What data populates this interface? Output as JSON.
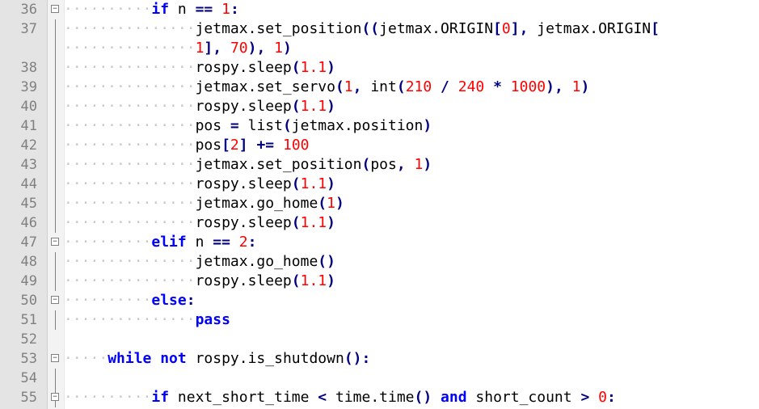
{
  "editor": {
    "lines": [
      {
        "n": "36",
        "fold": "minus",
        "indent": 2,
        "tokens": [
          [
            "kw",
            "if"
          ],
          [
            "def",
            " n "
          ],
          [
            "op",
            "=="
          ],
          [
            "def",
            " "
          ],
          [
            "num",
            "1"
          ],
          [
            "op",
            ":"
          ]
        ]
      },
      {
        "n": "37",
        "fold": "",
        "indent": 3,
        "tokens": [
          [
            "def",
            "jetmax.set_position"
          ],
          [
            "op",
            "(("
          ],
          [
            "def",
            "jetmax.ORIGIN"
          ],
          [
            "op",
            "["
          ],
          [
            "num",
            "0"
          ],
          [
            "op",
            "],"
          ],
          [
            "def",
            " jetmax.ORIGIN"
          ],
          [
            "op",
            "["
          ]
        ]
      },
      {
        "n": "",
        "fold": "",
        "indent": 3,
        "tokens": [
          [
            "num",
            "1"
          ],
          [
            "op",
            "],"
          ],
          [
            "def",
            " "
          ],
          [
            "num",
            "70"
          ],
          [
            "op",
            "),"
          ],
          [
            "def",
            " "
          ],
          [
            "num",
            "1"
          ],
          [
            "op",
            ")"
          ]
        ]
      },
      {
        "n": "38",
        "fold": "",
        "indent": 3,
        "tokens": [
          [
            "def",
            "rospy.sleep"
          ],
          [
            "op",
            "("
          ],
          [
            "num",
            "1.1"
          ],
          [
            "op",
            ")"
          ]
        ]
      },
      {
        "n": "39",
        "fold": "",
        "indent": 3,
        "tokens": [
          [
            "def",
            "jetmax.set_servo"
          ],
          [
            "op",
            "("
          ],
          [
            "num",
            "1"
          ],
          [
            "op",
            ","
          ],
          [
            "def",
            " int"
          ],
          [
            "op",
            "("
          ],
          [
            "num",
            "210"
          ],
          [
            "def",
            " "
          ],
          [
            "op",
            "/"
          ],
          [
            "def",
            " "
          ],
          [
            "num",
            "240"
          ],
          [
            "def",
            " "
          ],
          [
            "op",
            "*"
          ],
          [
            "def",
            " "
          ],
          [
            "num",
            "1000"
          ],
          [
            "op",
            "),"
          ],
          [
            "def",
            " "
          ],
          [
            "num",
            "1"
          ],
          [
            "op",
            ")"
          ]
        ]
      },
      {
        "n": "40",
        "fold": "",
        "indent": 3,
        "tokens": [
          [
            "def",
            "rospy.sleep"
          ],
          [
            "op",
            "("
          ],
          [
            "num",
            "1.1"
          ],
          [
            "op",
            ")"
          ]
        ]
      },
      {
        "n": "41",
        "fold": "",
        "indent": 3,
        "tokens": [
          [
            "def",
            "pos "
          ],
          [
            "op",
            "="
          ],
          [
            "def",
            " list"
          ],
          [
            "op",
            "("
          ],
          [
            "def",
            "jetmax.position"
          ],
          [
            "op",
            ")"
          ]
        ]
      },
      {
        "n": "42",
        "fold": "",
        "indent": 3,
        "tokens": [
          [
            "def",
            "pos"
          ],
          [
            "op",
            "["
          ],
          [
            "num",
            "2"
          ],
          [
            "op",
            "]"
          ],
          [
            "def",
            " "
          ],
          [
            "op",
            "+="
          ],
          [
            "def",
            " "
          ],
          [
            "num",
            "100"
          ]
        ]
      },
      {
        "n": "43",
        "fold": "",
        "indent": 3,
        "tokens": [
          [
            "def",
            "jetmax.set_position"
          ],
          [
            "op",
            "("
          ],
          [
            "def",
            "pos"
          ],
          [
            "op",
            ","
          ],
          [
            "def",
            " "
          ],
          [
            "num",
            "1"
          ],
          [
            "op",
            ")"
          ]
        ]
      },
      {
        "n": "44",
        "fold": "",
        "indent": 3,
        "tokens": [
          [
            "def",
            "rospy.sleep"
          ],
          [
            "op",
            "("
          ],
          [
            "num",
            "1.1"
          ],
          [
            "op",
            ")"
          ]
        ]
      },
      {
        "n": "45",
        "fold": "",
        "indent": 3,
        "tokens": [
          [
            "def",
            "jetmax.go_home"
          ],
          [
            "op",
            "("
          ],
          [
            "num",
            "1"
          ],
          [
            "op",
            ")"
          ]
        ]
      },
      {
        "n": "46",
        "fold": "",
        "indent": 3,
        "tokens": [
          [
            "def",
            "rospy.sleep"
          ],
          [
            "op",
            "("
          ],
          [
            "num",
            "1.1"
          ],
          [
            "op",
            ")"
          ]
        ]
      },
      {
        "n": "47",
        "fold": "minus",
        "indent": 2,
        "tokens": [
          [
            "kw",
            "elif"
          ],
          [
            "def",
            " n "
          ],
          [
            "op",
            "=="
          ],
          [
            "def",
            " "
          ],
          [
            "num",
            "2"
          ],
          [
            "op",
            ":"
          ]
        ]
      },
      {
        "n": "48",
        "fold": "",
        "indent": 3,
        "tokens": [
          [
            "def",
            "jetmax.go_home"
          ],
          [
            "op",
            "()"
          ]
        ]
      },
      {
        "n": "49",
        "fold": "",
        "indent": 3,
        "tokens": [
          [
            "def",
            "rospy.sleep"
          ],
          [
            "op",
            "("
          ],
          [
            "num",
            "1.1"
          ],
          [
            "op",
            ")"
          ]
        ]
      },
      {
        "n": "50",
        "fold": "minus",
        "indent": 2,
        "tokens": [
          [
            "kw",
            "else"
          ],
          [
            "op",
            ":"
          ]
        ]
      },
      {
        "n": "51",
        "fold": "",
        "indent": 3,
        "tokens": [
          [
            "kw",
            "pass"
          ]
        ]
      },
      {
        "n": "52",
        "fold": "",
        "indent": 0,
        "tokens": []
      },
      {
        "n": "53",
        "fold": "minus",
        "indent": 1,
        "tokens": [
          [
            "kw",
            "while"
          ],
          [
            "def",
            " "
          ],
          [
            "kw",
            "not"
          ],
          [
            "def",
            " rospy.is_shutdown"
          ],
          [
            "op",
            "():"
          ]
        ]
      },
      {
        "n": "54",
        "fold": "",
        "indent": 0,
        "tokens": []
      },
      {
        "n": "55",
        "fold": "minus",
        "indent": 2,
        "tokens": [
          [
            "kw",
            "if"
          ],
          [
            "def",
            " next_short_time "
          ],
          [
            "op",
            "<"
          ],
          [
            "def",
            " time.time"
          ],
          [
            "op",
            "()"
          ],
          [
            "def",
            " "
          ],
          [
            "kw",
            "and"
          ],
          [
            "def",
            " short_count "
          ],
          [
            "op",
            ">"
          ],
          [
            "def",
            " "
          ],
          [
            "num",
            "0"
          ],
          [
            "op",
            ":"
          ]
        ]
      }
    ]
  }
}
